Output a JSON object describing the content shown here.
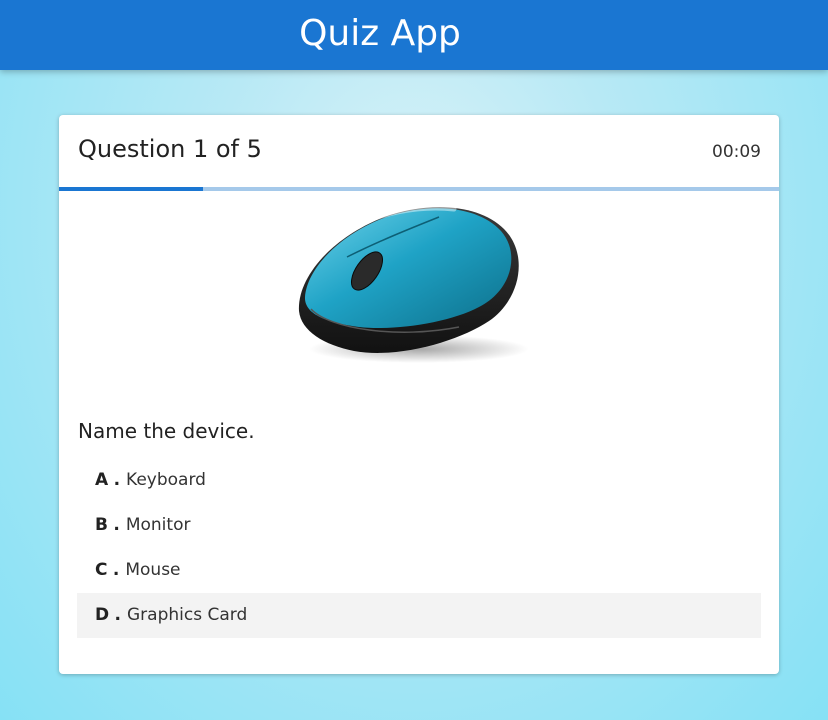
{
  "header": {
    "title": "Quiz App",
    "background": "#1a76d2"
  },
  "quiz": {
    "question_counter": "Question 1 of 5",
    "timer": "00:09",
    "progress_fraction": 0.2,
    "image": {
      "icon": "computer-mouse",
      "body_color": "#1fa3c6"
    },
    "question_text": "Name the device.",
    "options": [
      {
        "letter": "A",
        "separator": ".",
        "text": "Keyboard"
      },
      {
        "letter": "B",
        "separator": ".",
        "text": "Monitor"
      },
      {
        "letter": "C",
        "separator": ".",
        "text": "Mouse"
      },
      {
        "letter": "D",
        "separator": ".",
        "text": "Graphics Card"
      }
    ],
    "highlighted_option": "D"
  }
}
